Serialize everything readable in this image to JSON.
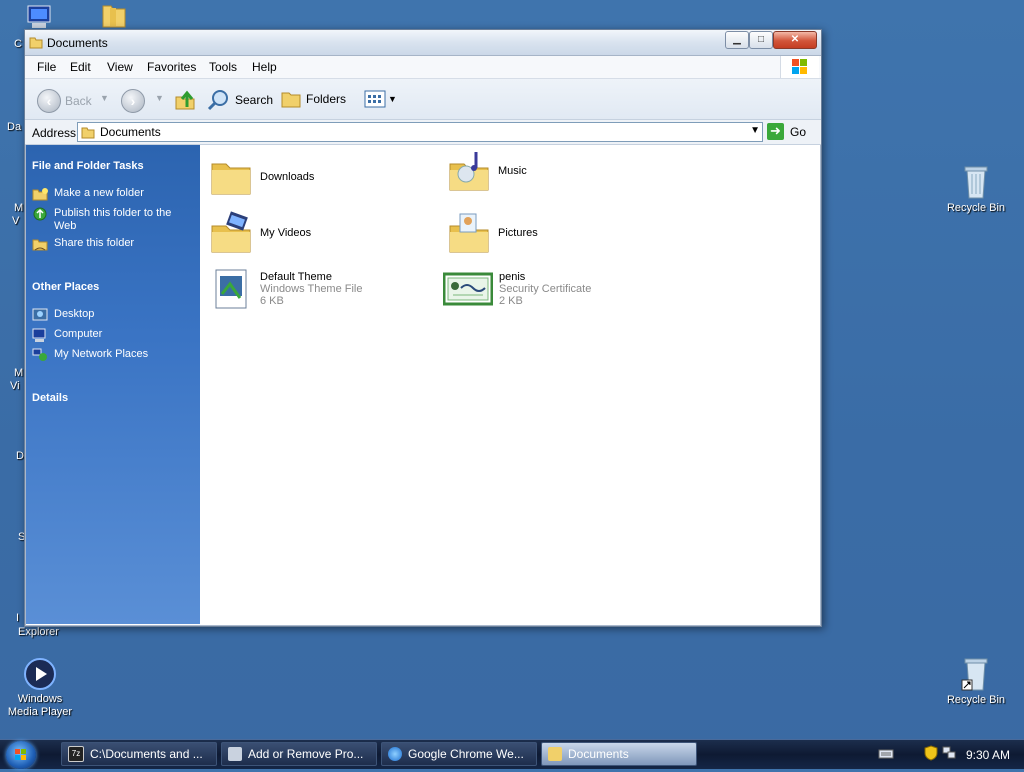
{
  "desktop": {
    "icons": {
      "wmp": {
        "line1": "Windows",
        "line2": "Media Player"
      },
      "recycle_top": "Recycle Bin",
      "recycle_bottom": "Recycle Bin",
      "explorer_label": "Explorer"
    },
    "clipped_letters": [
      "C",
      "Da",
      "M",
      "V",
      "M",
      "Vi",
      "D",
      "S",
      "I"
    ]
  },
  "window": {
    "title": "Documents",
    "controls": {
      "minimize": "▁",
      "maximize": "□",
      "close": "✕"
    },
    "menu": [
      "File",
      "Edit",
      "View",
      "Favorites",
      "Tools",
      "Help"
    ],
    "toolbar": {
      "back": "Back",
      "search": "Search",
      "folders": "Folders"
    },
    "address": {
      "label": "Address",
      "value": "Documents",
      "go": "Go"
    },
    "sidepanel": {
      "tasks_title": "File and Folder Tasks",
      "tasks": [
        "Make a new folder",
        "Publish this folder to the Web",
        "Share this folder"
      ],
      "places_title": "Other Places",
      "places": [
        "Desktop",
        "Computer",
        "My Network Places"
      ],
      "details_title": "Details"
    },
    "files": [
      {
        "name": "Downloads",
        "type": "",
        "size": "",
        "icon": "folder-icon"
      },
      {
        "name": "Music",
        "type": "",
        "size": "",
        "icon": "music-folder-icon"
      },
      {
        "name": "My Videos",
        "type": "",
        "size": "",
        "icon": "videos-folder-icon"
      },
      {
        "name": "Pictures",
        "type": "",
        "size": "",
        "icon": "pictures-folder-icon"
      },
      {
        "name": "Default Theme",
        "type": "Windows Theme File",
        "size": "6 KB",
        "icon": "theme-file-icon"
      },
      {
        "name": "penis",
        "type": "Security Certificate",
        "size": "2 KB",
        "icon": "certificate-icon"
      }
    ]
  },
  "taskbar": {
    "tasks": [
      {
        "label": "C:\\Documents and ...",
        "icon": "7zip-icon"
      },
      {
        "label": "Add or Remove Pro...",
        "icon": "add-remove-programs-icon"
      },
      {
        "label": "Google Chrome We...",
        "icon": "ie-icon"
      },
      {
        "label": "Documents",
        "icon": "folder-icon"
      }
    ],
    "clock": "9:30 AM"
  },
  "colors": {
    "accent": "#3a6ea5",
    "sidepanel": "#2c64b0",
    "folder": "#f3d36b"
  }
}
